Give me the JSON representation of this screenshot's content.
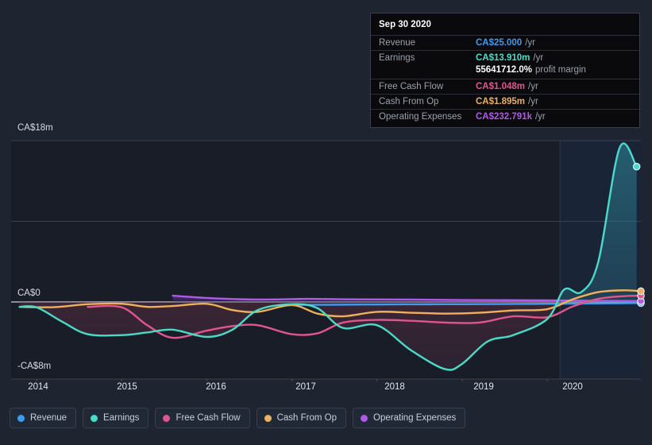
{
  "tooltip": {
    "date": "Sep 30 2020",
    "rows": [
      {
        "name": "Revenue",
        "value": "CA$25.000",
        "unit": "/yr",
        "color": "#3d9bf0"
      },
      {
        "name": "Earnings",
        "value": "CA$13.910m",
        "unit": "/yr",
        "color": "#4adbc8"
      },
      {
        "name": "Free Cash Flow",
        "value": "CA$1.048m",
        "unit": "/yr",
        "color": "#e0558d"
      },
      {
        "name": "Cash From Op",
        "value": "CA$1.895m",
        "unit": "/yr",
        "color": "#eeb05a"
      },
      {
        "name": "Operating Expenses",
        "value": "CA$232.791k",
        "unit": "/yr",
        "color": "#b05ae8"
      }
    ],
    "margin_value": "55641712.0%",
    "margin_label": "profit margin"
  },
  "legend": [
    {
      "label": "Revenue",
      "color": "#3d9bf0"
    },
    {
      "label": "Earnings",
      "color": "#4adbc8"
    },
    {
      "label": "Free Cash Flow",
      "color": "#e0558d"
    },
    {
      "label": "Cash From Op",
      "color": "#eeb05a"
    },
    {
      "label": "Operating Expenses",
      "color": "#b05ae8"
    }
  ],
  "axes": {
    "y_ticks": [
      {
        "label": "CA$18m",
        "value": 18
      },
      {
        "label": "CA$0",
        "value": 0
      },
      {
        "label": "-CA$8m",
        "value": -8
      }
    ],
    "x_ticks": [
      "2014",
      "2015",
      "2016",
      "2017",
      "2018",
      "2019",
      "2020"
    ]
  },
  "chart_data": {
    "type": "area",
    "title": "",
    "xlabel": "",
    "ylabel": "CA$",
    "ylim": [
      -8,
      18
    ],
    "xlim": [
      2013.7,
      2021.1
    ],
    "grid": true,
    "legend_position": "bottom",
    "currency": "CA$",
    "units": "millions",
    "forecast_start": 2020.15,
    "zero_line": 0,
    "series": [
      {
        "name": "Revenue",
        "color": "#3d9bf0",
        "x": [
          2017.0,
          2017.3,
          2017.6,
          2018.0,
          2018.4,
          2018.8,
          2019.2,
          2019.6,
          2020.0,
          2020.4,
          2020.8,
          2021.1
        ],
        "values": [
          -0.3,
          -0.32,
          -0.3,
          -0.28,
          -0.26,
          -0.25,
          -0.24,
          -0.22,
          -0.2,
          -0.18,
          -0.15,
          -0.12
        ]
      },
      {
        "name": "Earnings",
        "color": "#4adbc8",
        "x": [
          2013.8,
          2014.0,
          2014.3,
          2014.6,
          2015.0,
          2015.3,
          2015.6,
          2016.0,
          2016.3,
          2016.6,
          2017.0,
          2017.3,
          2017.6,
          2018.0,
          2018.4,
          2018.8,
          2019.0,
          2019.3,
          2019.6,
          2020.0,
          2020.2,
          2020.4,
          2020.6,
          2020.85,
          2021.05
        ],
        "values": [
          -0.55,
          -0.6,
          -2.2,
          -3.6,
          -3.7,
          -3.4,
          -3.1,
          -3.9,
          -3.1,
          -0.9,
          -0.25,
          -0.7,
          -2.9,
          -2.6,
          -5.4,
          -7.5,
          -6.9,
          -4.4,
          -3.7,
          -1.9,
          1.4,
          1.1,
          4.5,
          17.2,
          15.1
        ]
      },
      {
        "name": "Free Cash Flow",
        "color": "#e0558d",
        "x": [
          2014.6,
          2015.0,
          2015.3,
          2015.6,
          2016.0,
          2016.3,
          2016.6,
          2017.0,
          2017.3,
          2017.6,
          2018.0,
          2018.4,
          2018.8,
          2019.2,
          2019.6,
          2020.0,
          2020.3,
          2020.6,
          2020.9,
          2021.1
        ],
        "values": [
          -0.55,
          -0.6,
          -2.6,
          -4.0,
          -3.2,
          -2.7,
          -2.6,
          -3.6,
          -3.5,
          -2.3,
          -2.0,
          -2.1,
          -2.3,
          -2.3,
          -1.6,
          -1.7,
          -0.5,
          0.35,
          0.65,
          0.7
        ]
      },
      {
        "name": "Cash From Op",
        "color": "#eeb05a",
        "x": [
          2013.8,
          2014.2,
          2014.6,
          2015.0,
          2015.3,
          2015.6,
          2016.0,
          2016.3,
          2016.6,
          2017.0,
          2017.3,
          2017.6,
          2018.0,
          2018.4,
          2018.8,
          2019.2,
          2019.6,
          2020.0,
          2020.3,
          2020.6,
          2020.9,
          2021.1
        ],
        "values": [
          -0.55,
          -0.58,
          -0.25,
          -0.2,
          -0.55,
          -0.45,
          -0.2,
          -0.9,
          -1.1,
          -0.35,
          -1.3,
          -1.6,
          -1.1,
          -1.2,
          -1.3,
          -1.2,
          -0.95,
          -0.8,
          0.3,
          1.1,
          1.3,
          1.2
        ]
      },
      {
        "name": "Operating Expenses",
        "color": "#b05ae8",
        "x": [
          2015.6,
          2016.0,
          2016.4,
          2016.8,
          2017.2,
          2017.6,
          2018.0,
          2018.5,
          2019.0,
          2019.5,
          2020.0,
          2020.5,
          2021.1
        ],
        "values": [
          0.7,
          0.45,
          0.3,
          0.28,
          0.35,
          0.3,
          0.28,
          0.26,
          0.22,
          0.2,
          0.18,
          0.14,
          0.1
        ]
      }
    ]
  }
}
